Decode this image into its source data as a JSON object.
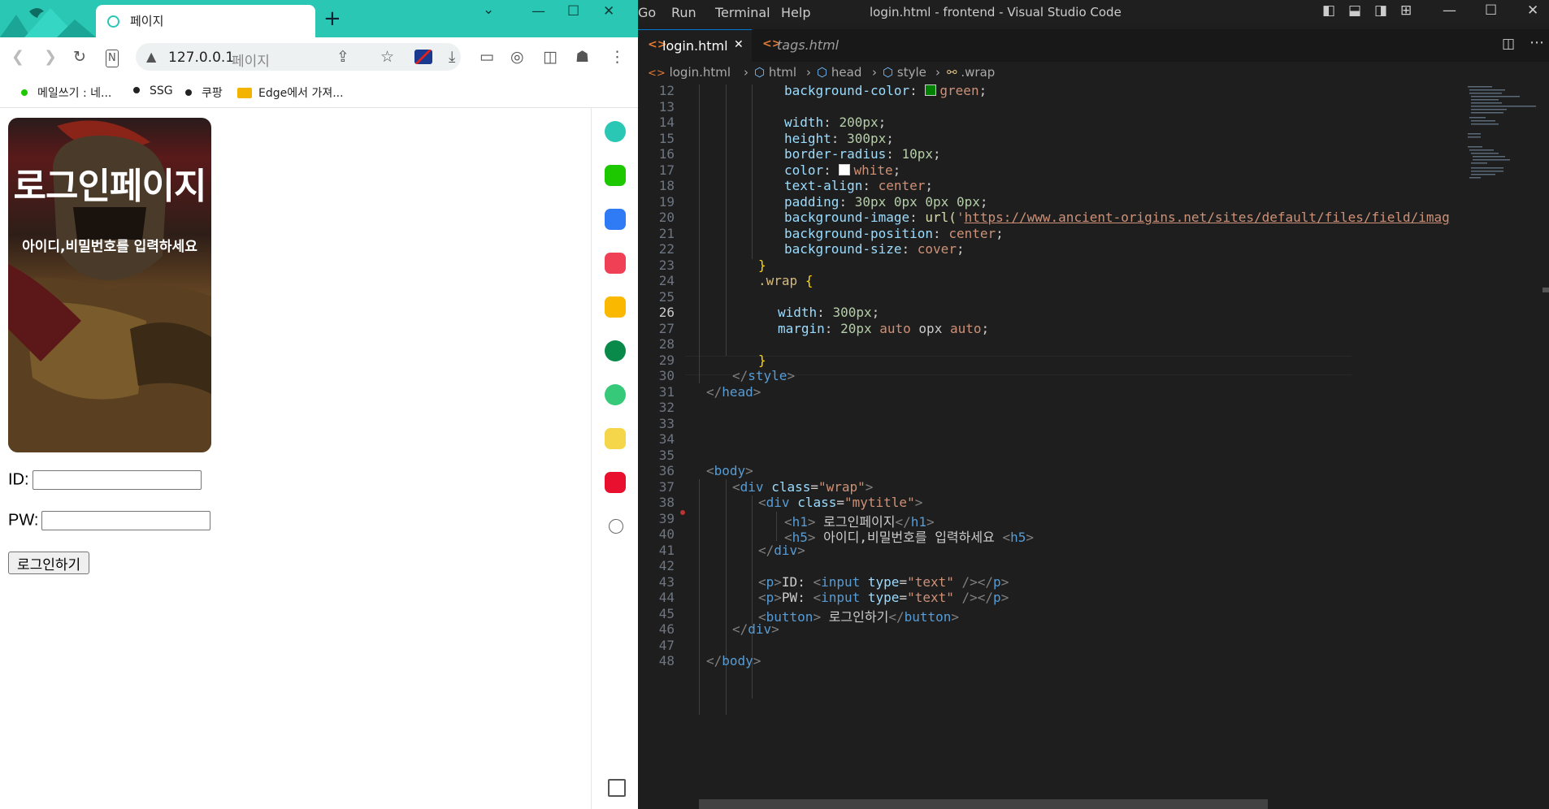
{
  "browser": {
    "tab_title": "페이지",
    "new_tab": "+",
    "address_host": "127.0.0.1",
    "address_page": "페이지",
    "bookmarks": [
      "메일쓰기 : 네...",
      "SSG",
      "쿠팡",
      "Edge에서 가져..."
    ],
    "page": {
      "h1": "로그인페이지",
      "h5": "아이디,비밀번호를 입력하세요",
      "id_label": "ID:",
      "pw_label": "PW:",
      "button": "로그인하기",
      "id_value": "",
      "pw_value": ""
    },
    "colors": {
      "frame": "#2ac7b5"
    }
  },
  "vscode": {
    "menu": [
      "Go",
      "Run",
      "Terminal",
      "Help"
    ],
    "window_title": "login.html - frontend - Visual Studio Code",
    "tabs": [
      {
        "name": "login.html",
        "active": true,
        "close": "✕"
      },
      {
        "name": "tags.html",
        "active": false
      }
    ],
    "breadcrumb": [
      "login.html",
      "html",
      "head",
      "style",
      ".wrap"
    ],
    "current_line": 26,
    "lines": [
      {
        "n": "12"
      },
      {
        "n": "13"
      },
      {
        "n": "14"
      },
      {
        "n": "15"
      },
      {
        "n": "16"
      },
      {
        "n": "17"
      },
      {
        "n": "18"
      },
      {
        "n": "19"
      },
      {
        "n": "20"
      },
      {
        "n": "21"
      },
      {
        "n": "22"
      },
      {
        "n": "23"
      },
      {
        "n": "24"
      },
      {
        "n": "25"
      },
      {
        "n": "26"
      },
      {
        "n": "27"
      },
      {
        "n": "28"
      },
      {
        "n": "29"
      },
      {
        "n": "30"
      },
      {
        "n": "31"
      },
      {
        "n": "32"
      },
      {
        "n": "33"
      },
      {
        "n": "34"
      },
      {
        "n": "35"
      },
      {
        "n": "36"
      },
      {
        "n": "37"
      },
      {
        "n": "38"
      },
      {
        "n": "39"
      },
      {
        "n": "40"
      },
      {
        "n": "41"
      },
      {
        "n": "42"
      },
      {
        "n": "43"
      },
      {
        "n": "44"
      },
      {
        "n": "45"
      },
      {
        "n": "46"
      },
      {
        "n": "47"
      },
      {
        "n": "48"
      }
    ],
    "code": {
      "l12": [
        "background-color",
        ":",
        "green",
        ";"
      ],
      "l14": [
        "width",
        ":",
        "200px",
        ";"
      ],
      "l15": [
        "height",
        ":",
        "300px",
        ";"
      ],
      "l16": [
        "border-radius",
        ":",
        "10px",
        ";"
      ],
      "l17": [
        "color",
        ":",
        "white",
        ";"
      ],
      "l18": [
        "text-align",
        ":",
        "center",
        ";"
      ],
      "l19": [
        "padding",
        ":",
        "30px 0px 0px 0px",
        ";"
      ],
      "l20": [
        "background-image",
        ":",
        "url(",
        "'",
        "https://www.ancient-origins.net/sites/default/files/field/imag"
      ],
      "l21": [
        "background-position",
        ":",
        "center",
        ";"
      ],
      "l22": [
        "background-size",
        ":",
        "cover",
        ";"
      ],
      "l23": "}",
      "l24": [
        ".wrap",
        "{"
      ],
      "l26": [
        "width",
        ":",
        "300px",
        ";"
      ],
      "l27": [
        "margin",
        ":",
        "20px",
        "auto",
        "opx",
        "auto",
        ";"
      ],
      "l29": "}",
      "l30": [
        "</",
        "style",
        ">"
      ],
      "l31": [
        "</",
        "head",
        ">"
      ],
      "l36": [
        "<",
        "body",
        ">"
      ],
      "l37": [
        "<",
        "div",
        "class",
        "=",
        "\"wrap\"",
        ">"
      ],
      "l38": [
        "<",
        "div",
        "class",
        "=",
        "\"mytitle\"",
        ">"
      ],
      "l39": [
        "<",
        "h1",
        ">",
        " 로그인페이지",
        "</",
        "h1",
        ">"
      ],
      "l40": [
        "<",
        "h5",
        ">",
        " 아이디,비밀번호를 입력하세요 ",
        "<",
        "h5",
        ">"
      ],
      "l41": [
        "</",
        "div",
        ">"
      ],
      "l43": [
        "<",
        "p",
        ">",
        "ID: ",
        "<",
        "input",
        "type",
        "=",
        "\"text\"",
        " />",
        "</",
        "p",
        ">"
      ],
      "l44": [
        "<",
        "p",
        ">",
        "PW: ",
        "<",
        "input",
        "type",
        "=",
        "\"text\"",
        " />",
        "</",
        "p",
        ">"
      ],
      "l45": [
        "<",
        "button",
        ">",
        " 로그인하기",
        "</",
        "button",
        ">"
      ],
      "l46": [
        "</",
        "div",
        ">"
      ],
      "l48": [
        "</",
        "body",
        ">"
      ]
    }
  }
}
